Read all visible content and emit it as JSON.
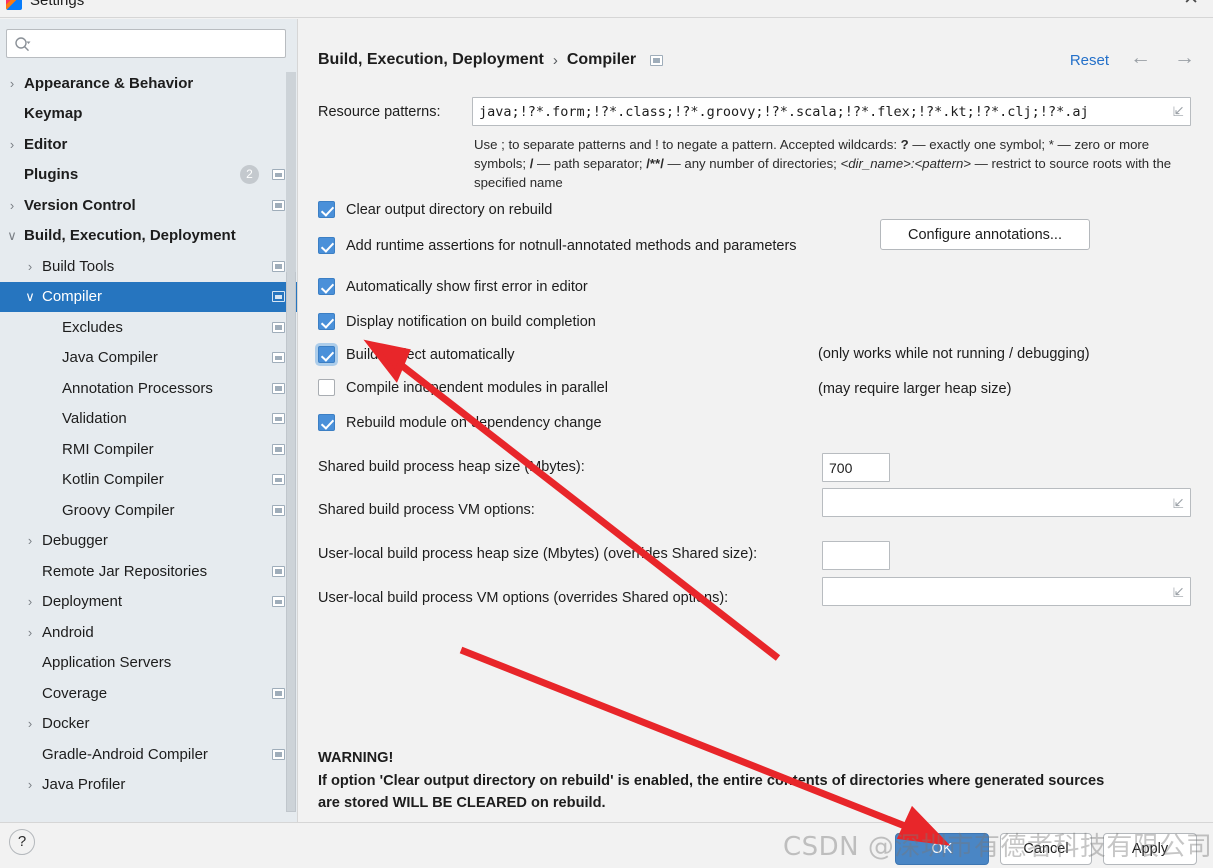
{
  "window": {
    "title": "Settings",
    "close_label": "✕",
    "app_icon": "intellij-idea-icon"
  },
  "sidebar": {
    "search": {
      "value": "",
      "placeholder": "",
      "icon": "search-icon"
    },
    "items": [
      {
        "label": "Appearance & Behavior",
        "depth": 0,
        "chev": "›",
        "bold": true,
        "selected": false,
        "cfg": false,
        "badge": ""
      },
      {
        "label": "Keymap",
        "depth": 0,
        "chev": "",
        "bold": true,
        "selected": false,
        "cfg": false,
        "badge": ""
      },
      {
        "label": "Editor",
        "depth": 0,
        "chev": "›",
        "bold": true,
        "selected": false,
        "cfg": false,
        "badge": ""
      },
      {
        "label": "Plugins",
        "depth": 0,
        "chev": "",
        "bold": true,
        "selected": false,
        "cfg": true,
        "badge": "2"
      },
      {
        "label": "Version Control",
        "depth": 0,
        "chev": "›",
        "bold": true,
        "selected": false,
        "cfg": true,
        "badge": ""
      },
      {
        "label": "Build, Execution, Deployment",
        "depth": 0,
        "chev": "∨",
        "bold": true,
        "selected": false,
        "cfg": false,
        "badge": ""
      },
      {
        "label": "Build Tools",
        "depth": 1,
        "chev": "›",
        "bold": false,
        "selected": false,
        "cfg": true,
        "badge": ""
      },
      {
        "label": "Compiler",
        "depth": 1,
        "chev": "∨",
        "bold": false,
        "selected": true,
        "cfg": true,
        "badge": ""
      },
      {
        "label": "Excludes",
        "depth": 2,
        "chev": "",
        "bold": false,
        "selected": false,
        "cfg": true,
        "badge": ""
      },
      {
        "label": "Java Compiler",
        "depth": 2,
        "chev": "",
        "bold": false,
        "selected": false,
        "cfg": true,
        "badge": ""
      },
      {
        "label": "Annotation Processors",
        "depth": 2,
        "chev": "",
        "bold": false,
        "selected": false,
        "cfg": true,
        "badge": ""
      },
      {
        "label": "Validation",
        "depth": 2,
        "chev": "",
        "bold": false,
        "selected": false,
        "cfg": true,
        "badge": ""
      },
      {
        "label": "RMI Compiler",
        "depth": 2,
        "chev": "",
        "bold": false,
        "selected": false,
        "cfg": true,
        "badge": ""
      },
      {
        "label": "Kotlin Compiler",
        "depth": 2,
        "chev": "",
        "bold": false,
        "selected": false,
        "cfg": true,
        "badge": ""
      },
      {
        "label": "Groovy Compiler",
        "depth": 2,
        "chev": "",
        "bold": false,
        "selected": false,
        "cfg": true,
        "badge": ""
      },
      {
        "label": "Debugger",
        "depth": 1,
        "chev": "›",
        "bold": false,
        "selected": false,
        "cfg": false,
        "badge": ""
      },
      {
        "label": "Remote Jar Repositories",
        "depth": 1,
        "chev": "",
        "bold": false,
        "selected": false,
        "cfg": true,
        "badge": ""
      },
      {
        "label": "Deployment",
        "depth": 1,
        "chev": "›",
        "bold": false,
        "selected": false,
        "cfg": true,
        "badge": ""
      },
      {
        "label": "Android",
        "depth": 1,
        "chev": "›",
        "bold": false,
        "selected": false,
        "cfg": false,
        "badge": ""
      },
      {
        "label": "Application Servers",
        "depth": 1,
        "chev": "",
        "bold": false,
        "selected": false,
        "cfg": false,
        "badge": ""
      },
      {
        "label": "Coverage",
        "depth": 1,
        "chev": "",
        "bold": false,
        "selected": false,
        "cfg": true,
        "badge": ""
      },
      {
        "label": "Docker",
        "depth": 1,
        "chev": "›",
        "bold": false,
        "selected": false,
        "cfg": false,
        "badge": ""
      },
      {
        "label": "Gradle-Android Compiler",
        "depth": 1,
        "chev": "",
        "bold": false,
        "selected": false,
        "cfg": true,
        "badge": ""
      },
      {
        "label": "Java Profiler",
        "depth": 1,
        "chev": "›",
        "bold": false,
        "selected": false,
        "cfg": false,
        "badge": ""
      }
    ]
  },
  "header": {
    "breadcrumb_root": "Build, Execution, Deployment",
    "breadcrumb_sep": "›",
    "breadcrumb_leaf": "Compiler",
    "scope_icon": "project-scope-icon",
    "reset_label": "Reset",
    "back_icon": "←",
    "forward_icon": "→"
  },
  "main": {
    "resource_patterns": {
      "label": "Resource patterns:",
      "value": "java;!?*.form;!?*.class;!?*.groovy;!?*.scala;!?*.flex;!?*.kt;!?*.clj;!?*.aj",
      "expand_icon": "expand-icon"
    },
    "hint_line1_a": "Use ; to separate patterns and ! to negate a pattern. Accepted wildcards: ",
    "hint_q": "?",
    "hint_line1_b": " — exactly one symbol; * — zero or",
    "hint_line2_a": "more symbols; ",
    "hint_slash": "/",
    "hint_line2_b": " — path separator; ",
    "hint_globstar": "/**/",
    "hint_line2_c": " — any number of directories; ",
    "hint_dirname": "<dir_name>:<pattern>",
    "hint_line2_d": " — restrict to source",
    "hint_line3": "roots with the specified name",
    "checkboxes": [
      {
        "label": "Clear output directory on rebuild",
        "checked": true,
        "focused": false
      },
      {
        "label": "Add runtime assertions for notnull-annotated methods and parameters",
        "checked": true,
        "focused": false
      },
      {
        "label": "Automatically show first error in editor",
        "checked": true,
        "focused": false
      },
      {
        "label": "Display notification on build completion",
        "checked": true,
        "focused": false
      },
      {
        "label": "Build project automatically",
        "checked": true,
        "focused": true
      },
      {
        "label": "Compile independent modules in parallel",
        "checked": false,
        "focused": false
      },
      {
        "label": "Rebuild module on dependency change",
        "checked": true,
        "focused": false
      }
    ],
    "configure_annotations_button": "Configure annotations...",
    "note_build_auto": "(only works while not running / debugging)",
    "note_parallel": "(may require larger heap size)",
    "fields": [
      {
        "label": "Shared build process heap size (Mbytes):",
        "value": "700",
        "wide": false
      },
      {
        "label": "Shared build process VM options:",
        "value": "",
        "wide": true
      },
      {
        "label": "User-local build process heap size (Mbytes) (overrides Shared size):",
        "value": "",
        "wide": false
      },
      {
        "label": "User-local build process VM options (overrides Shared options):",
        "value": "",
        "wide": true
      }
    ],
    "warning_title": "WARNING!",
    "warning_line1": "If option 'Clear output directory on rebuild' is enabled, the entire contents of directories where generated sources",
    "warning_line2": "are stored WILL BE CLEARED on rebuild."
  },
  "footer": {
    "help_label": "?",
    "ok_label": "OK",
    "cancel_label": "Cancel",
    "apply_label": "Apply"
  },
  "overlay": {
    "watermark": "CSDN @深圳市有德者科技有限公司-耿瑞",
    "accent_color": "#2675bf",
    "annotation_color": "#e8262a"
  }
}
